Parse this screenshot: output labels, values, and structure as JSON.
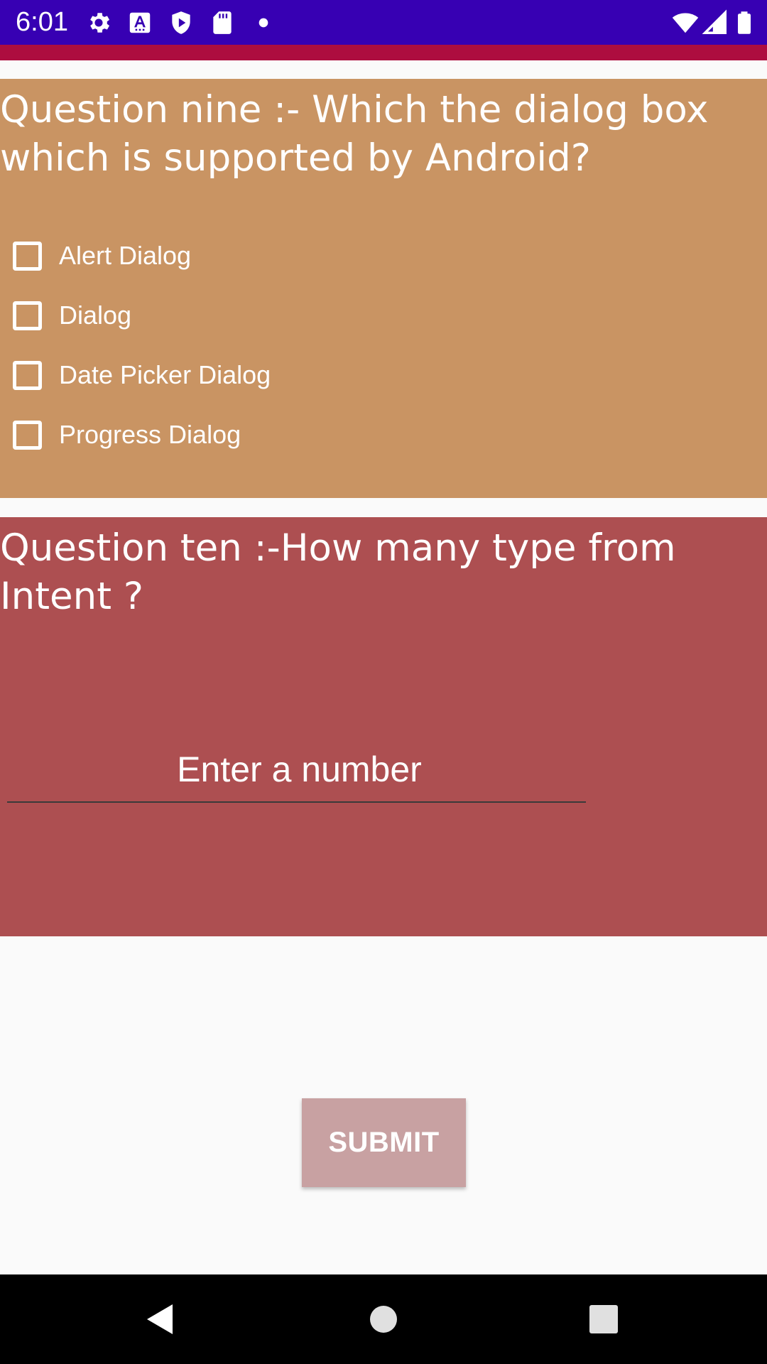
{
  "status_bar": {
    "time": "6:01",
    "icons": [
      "settings-icon",
      "font-icon",
      "shield-icon",
      "sd-card-icon",
      "dot-icon",
      "wifi-icon",
      "signal-icon",
      "battery-icon"
    ],
    "background_color": "#3700b3",
    "accent_color": "#ad0d3f"
  },
  "question_nine": {
    "title": "Question nine :- Which the dialog box which is supported by Android?",
    "background_color": "#c99463",
    "options": [
      {
        "label": "Alert Dialog",
        "checked": false
      },
      {
        "label": "Dialog",
        "checked": false
      },
      {
        "label": "Date Picker Dialog",
        "checked": false
      },
      {
        "label": "Progress Dialog",
        "checked": false
      }
    ]
  },
  "question_ten": {
    "title": "Question ten :-How many type from Intent ?",
    "background_color": "#ad4f51",
    "input": {
      "value": "",
      "placeholder": "Enter a number"
    }
  },
  "submit": {
    "label": "SUBMIT",
    "background_color": "#c8a1a2"
  },
  "nav_bar": {
    "icons": [
      "back-icon",
      "home-icon",
      "recents-icon"
    ]
  }
}
